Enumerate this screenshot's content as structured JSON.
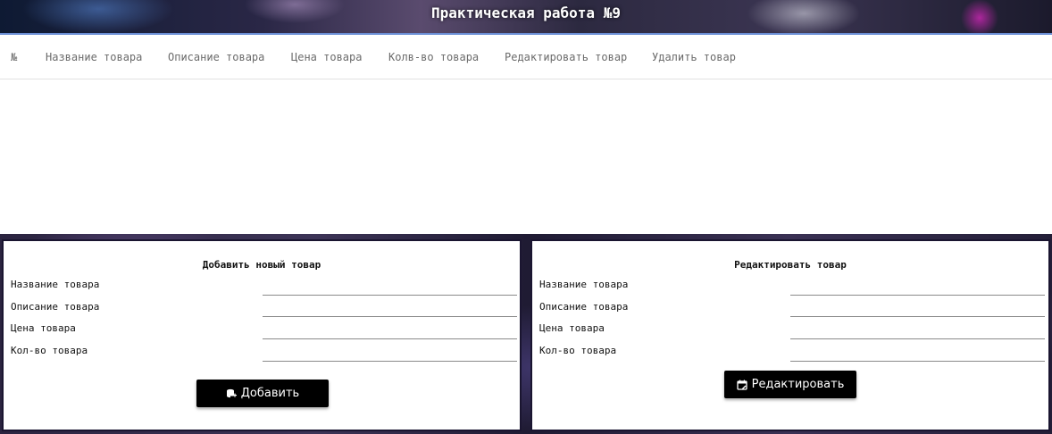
{
  "header": {
    "title": "Практическая работа №9"
  },
  "table": {
    "columns": [
      "№",
      "Название товара",
      "Описание товара",
      "Цена товара",
      "Колв-во товара",
      "Редактировать товар",
      "Удалить товар"
    ]
  },
  "add_form": {
    "title": "Добавить новый товар",
    "fields": [
      "Название товара",
      "Описание товара",
      "Цена товара",
      "Кол-во товара"
    ],
    "button_label": "Добавить",
    "button_icon": "database-add-icon"
  },
  "edit_form": {
    "title": "Редактировать товар",
    "fields": [
      "Название товара",
      "Описание товара",
      "Цена товара",
      "Кол-во товара"
    ],
    "button_label": "Редактировать",
    "button_icon": "calendar-edit-icon"
  },
  "colors": {
    "button_bg": "#000000",
    "panel_border": "#1a1530",
    "header_accent": "#6b8fd6"
  }
}
